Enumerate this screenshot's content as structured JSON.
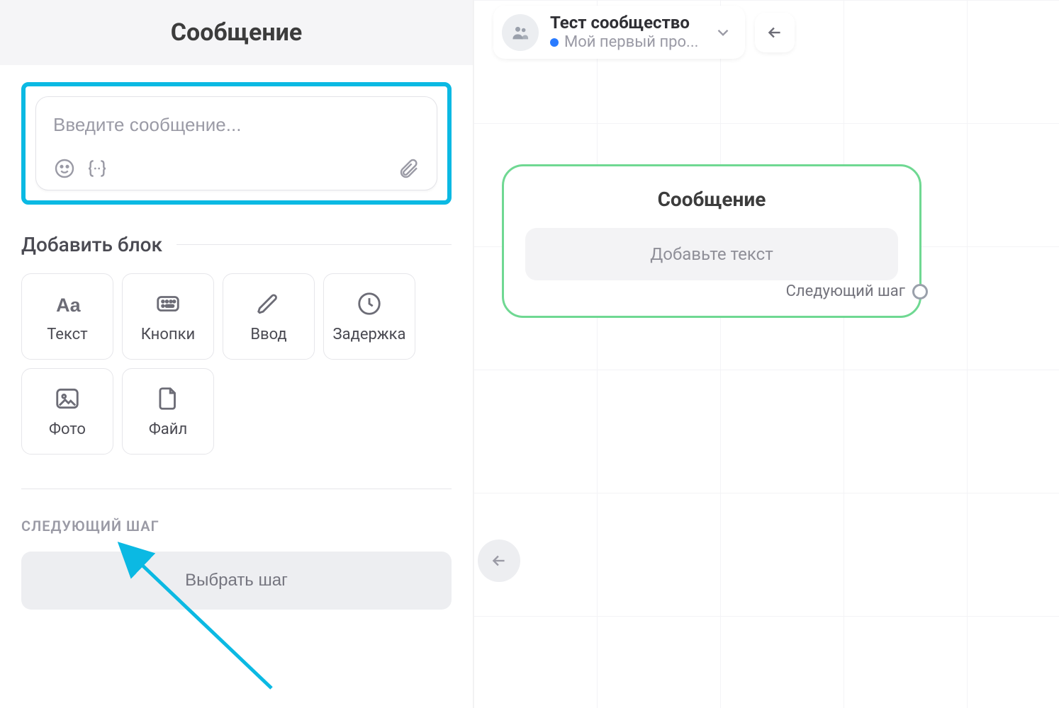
{
  "left": {
    "header_title": "Сообщение",
    "message_placeholder": "Введите сообщение...",
    "addblock_title": "Добавить блок",
    "blocks": [
      {
        "label": "Текст"
      },
      {
        "label": "Кнопки"
      },
      {
        "label": "Ввод"
      },
      {
        "label": "Задержка"
      },
      {
        "label": "Фото"
      },
      {
        "label": "Файл"
      }
    ],
    "next_step_caption": "СЛЕДУЮЩИЙ ШАГ",
    "choose_step_label": "Выбрать шаг"
  },
  "right": {
    "project": {
      "title": "Тест сообщество",
      "subtitle": "Мой первый про..."
    },
    "node": {
      "title": "Сообщение",
      "placeholder": "Добавьте текст",
      "next_label": "Следующий шаг"
    }
  }
}
